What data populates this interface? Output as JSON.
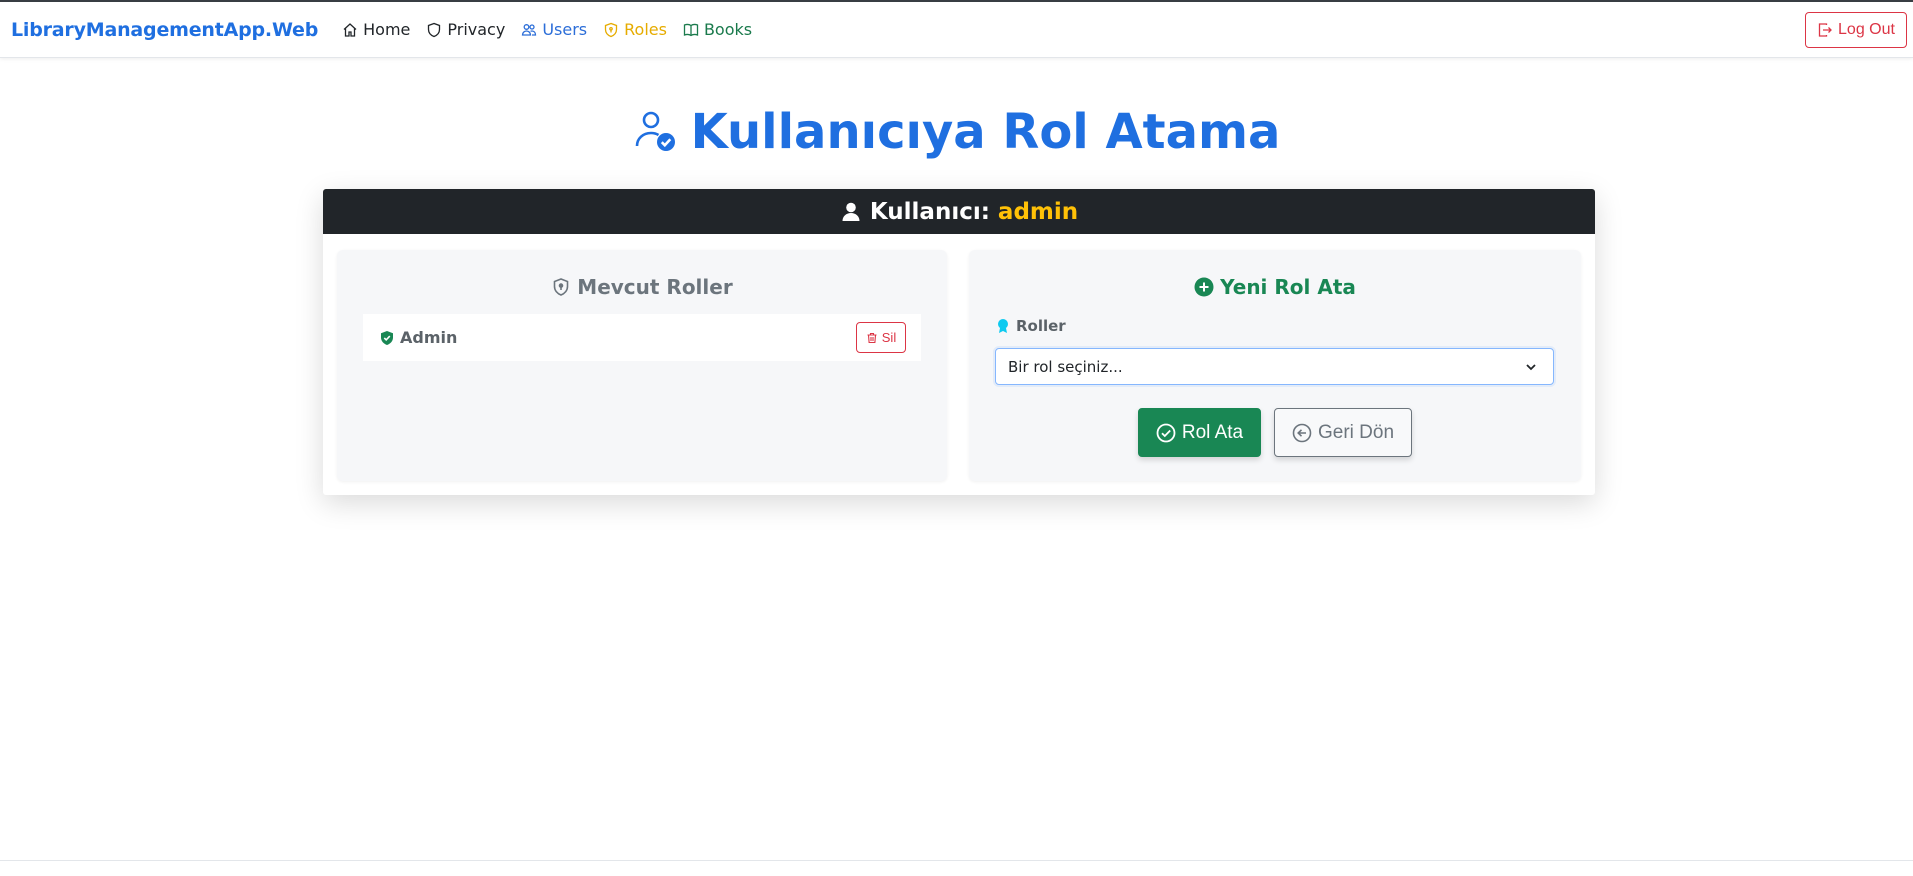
{
  "navbar": {
    "brand": "LibraryManagementApp.Web",
    "links": [
      {
        "label": "Home",
        "icon": "home-icon",
        "color": "#212529"
      },
      {
        "label": "Privacy",
        "icon": "shield-icon",
        "color": "#212529"
      },
      {
        "label": "Users",
        "icon": "users-icon",
        "color": "#2c6ed8"
      },
      {
        "label": "Roles",
        "icon": "shield-lock-icon",
        "color": "#e6ac00"
      },
      {
        "label": "Books",
        "icon": "book-icon",
        "color": "#1a7a4c"
      }
    ],
    "logout_label": "Log Out"
  },
  "page": {
    "title": "Kullanıcıya Rol Atama"
  },
  "card": {
    "header_label": "Kullanıcı:",
    "username": "admin"
  },
  "current_roles": {
    "title": "Mevcut Roller",
    "roles": [
      {
        "name": "Admin",
        "delete_label": "Sil"
      }
    ]
  },
  "assign_role": {
    "title": "Yeni Rol Ata",
    "field_label": "Roller",
    "select_value": "Bir rol seçiniz...",
    "submit_label": "Rol Ata",
    "back_label": "Geri Dön"
  },
  "colors": {
    "accent": "#1f6fe0",
    "success": "#198754",
    "danger": "#dc3545",
    "warning": "#ffc107",
    "header_bg": "#212529"
  }
}
